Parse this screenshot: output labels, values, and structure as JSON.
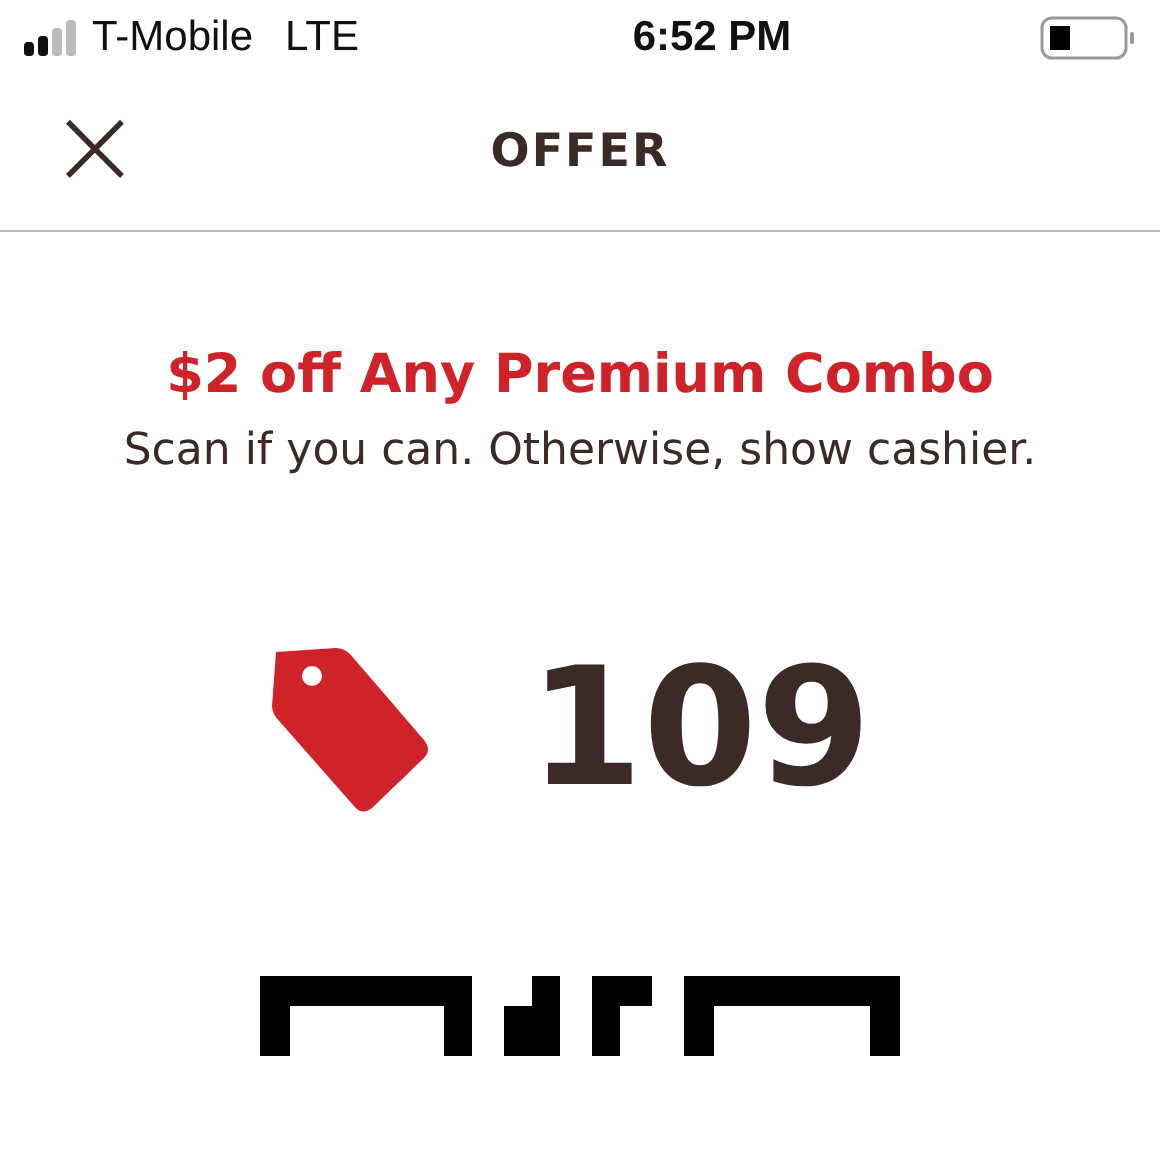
{
  "status_bar": {
    "carrier": "T-Mobile",
    "network": "LTE",
    "time": "6:52 PM"
  },
  "header": {
    "close": "×",
    "title": "OFFER"
  },
  "offer": {
    "title": "$2 off Any Premium Combo",
    "instructions": "Scan if you can. Otherwise, show cashier.",
    "code": "109"
  }
}
